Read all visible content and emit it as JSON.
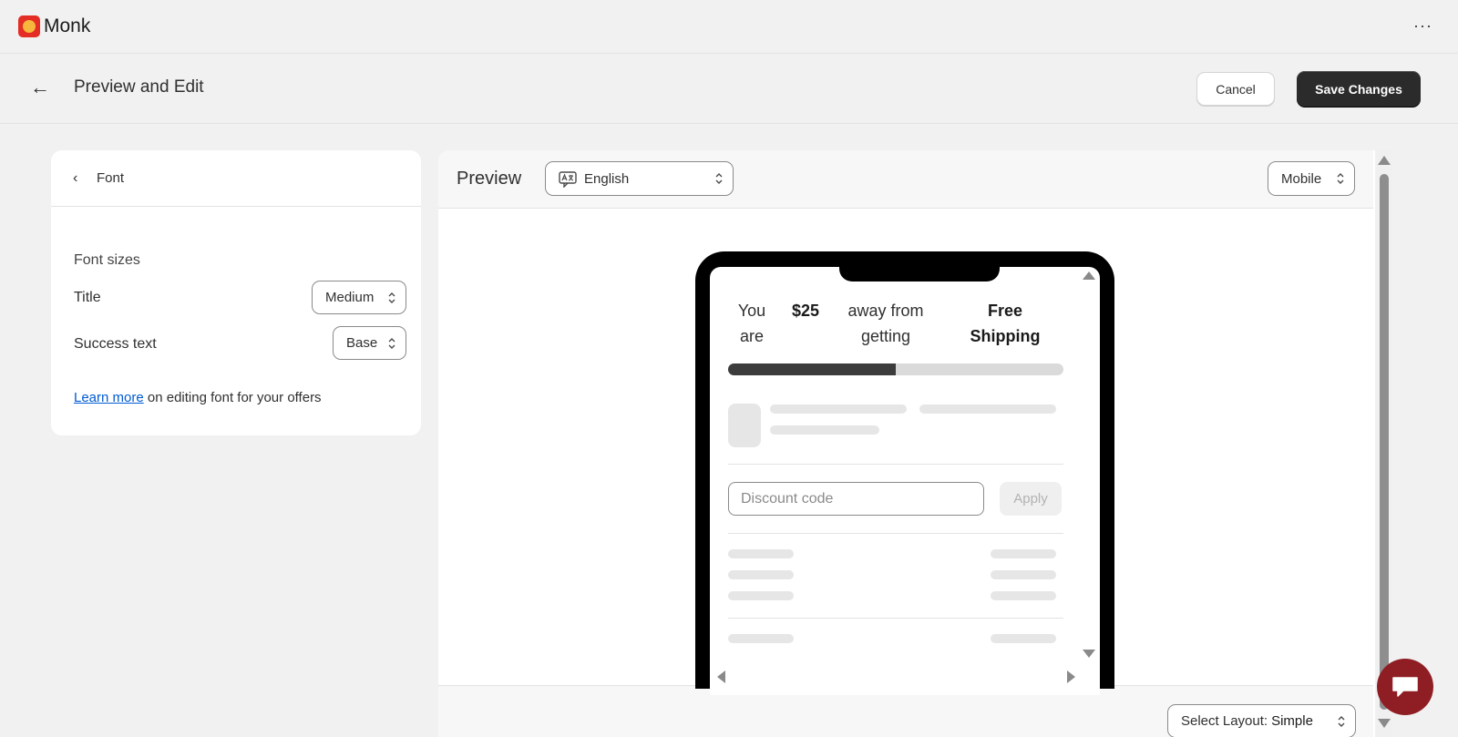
{
  "app": {
    "brand": "Monk",
    "brand_icon": "monk-logo-icon",
    "more_icon": "more-horizontal-icon",
    "more_label": "···"
  },
  "header": {
    "back_icon": "arrow-left-icon",
    "back_glyph": "←",
    "title": "Preview and Edit",
    "cancel_label": "Cancel",
    "save_label": "Save Changes"
  },
  "settings": {
    "back_glyph": "‹",
    "title": "Font",
    "section_label": "Font sizes",
    "rows": [
      {
        "label": "Title",
        "value": "Medium"
      },
      {
        "label": "Success text",
        "value": "Base"
      }
    ],
    "learn_link": "Learn more",
    "learn_suffix": " on editing font for your offers"
  },
  "preview": {
    "title": "Preview",
    "language": "English",
    "device": "Mobile",
    "layout_label": "Select Layout:",
    "layout_value": "Simple",
    "progress_fraction": 0.5,
    "message": {
      "you": "You",
      "are": "are",
      "amount": "$25",
      "away_from": "away from",
      "getting": "getting",
      "free": "Free",
      "shipping": "Shipping"
    },
    "discount_placeholder": "Discount code",
    "apply_label": "Apply"
  },
  "colors": {
    "primary_button": "#2b2b2b",
    "link": "#005bd3",
    "chat_bubble": "#8f1e24",
    "progress_fill": "#3c3c3c",
    "progress_track": "#dadada"
  }
}
